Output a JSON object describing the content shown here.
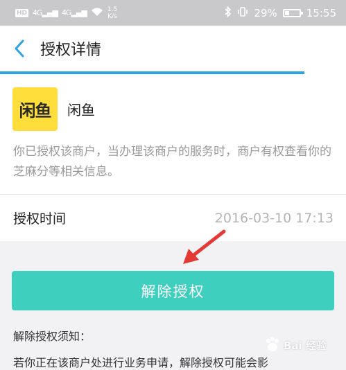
{
  "status_bar": {
    "network_badge": "HD",
    "signal1": "4G",
    "signal2": "4G",
    "speed_value": "1.5",
    "speed_unit": "K/s",
    "battery": "29%",
    "time": "15:55"
  },
  "nav": {
    "title": "授权详情",
    "back_icon": "chevron-left-icon",
    "progress": 0.88
  },
  "merchant": {
    "logo_text": "闲鱼",
    "name": "闲鱼",
    "logo_color": "#ffde3c"
  },
  "notice": "你已授权该商户，当办理该商户的服务时，商户有权查看你的芝麻分等相关信息。",
  "auth_time": {
    "label": "授权时间",
    "value": "2016-03-10 17:13"
  },
  "revoke_button": {
    "label": "解除授权",
    "color": "#3ecfbe"
  },
  "tips": {
    "title": "解除授权须知：",
    "body": "若你正在该商户处进行业务申请，解除授权可能会影"
  },
  "watermark": {
    "text": "Bai 经验"
  },
  "colors": {
    "accent": "#2ea3e6",
    "annotation_arrow": "#e53935"
  }
}
